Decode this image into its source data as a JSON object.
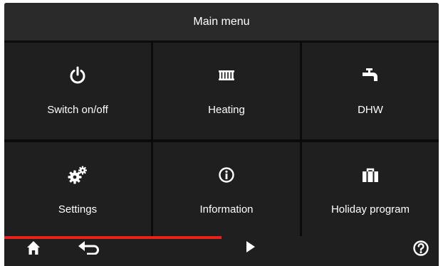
{
  "header": {
    "title": "Main menu"
  },
  "tiles": [
    {
      "label": "Switch on/off",
      "icon": "power-icon"
    },
    {
      "label": "Heating",
      "icon": "radiator-icon"
    },
    {
      "label": "DHW",
      "icon": "faucet-icon"
    },
    {
      "label": "Settings",
      "icon": "gears-icon"
    },
    {
      "label": "Information",
      "icon": "info-icon"
    },
    {
      "label": "Holiday program",
      "icon": "suitcase-icon"
    }
  ],
  "progress": {
    "fraction": 0.5
  },
  "bottombar": {
    "buttons": [
      {
        "icon": "home-icon"
      },
      {
        "icon": "back-arrow-icon"
      },
      {
        "icon": "play-icon"
      },
      {
        "icon": "help-icon"
      }
    ]
  },
  "colors": {
    "background": "#0b0b0b",
    "tile": "#1f1f1f",
    "titlebar": "#2a2a2a",
    "accent": "#e3231e",
    "text": "#ffffff"
  }
}
